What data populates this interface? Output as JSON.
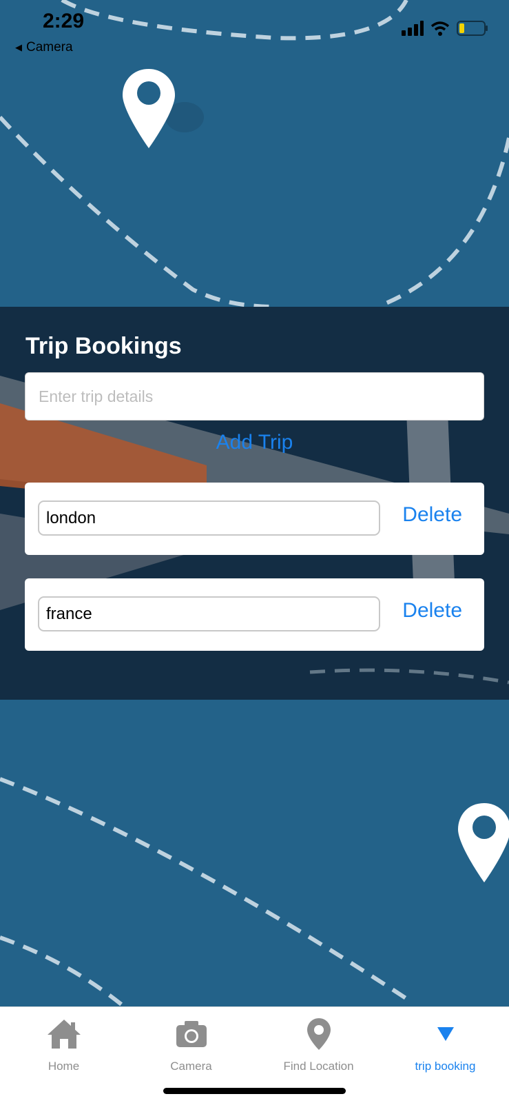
{
  "status_bar": {
    "time": "2:29",
    "back_label": "Camera"
  },
  "booking": {
    "title": "Trip Bookings",
    "input_placeholder": "Enter trip details",
    "input_value": "",
    "add_button_label": "Add Trip",
    "trips": [
      {
        "value": "london",
        "delete_label": "Delete"
      },
      {
        "value": "france",
        "delete_label": "Delete"
      }
    ]
  },
  "tab_bar": {
    "tabs": [
      {
        "label": "Home",
        "icon": "home-icon",
        "active": false
      },
      {
        "label": "Camera",
        "icon": "camera-icon",
        "active": false
      },
      {
        "label": "Find Location",
        "icon": "location-pin-icon",
        "active": false
      },
      {
        "label": "trip booking",
        "icon": "triangle-down-icon",
        "active": true
      }
    ]
  },
  "colors": {
    "background_blue": "#236289",
    "panel_dark": "#132d44",
    "accent_blue": "#1a82ee",
    "inactive_tab": "#8e8e8e"
  }
}
